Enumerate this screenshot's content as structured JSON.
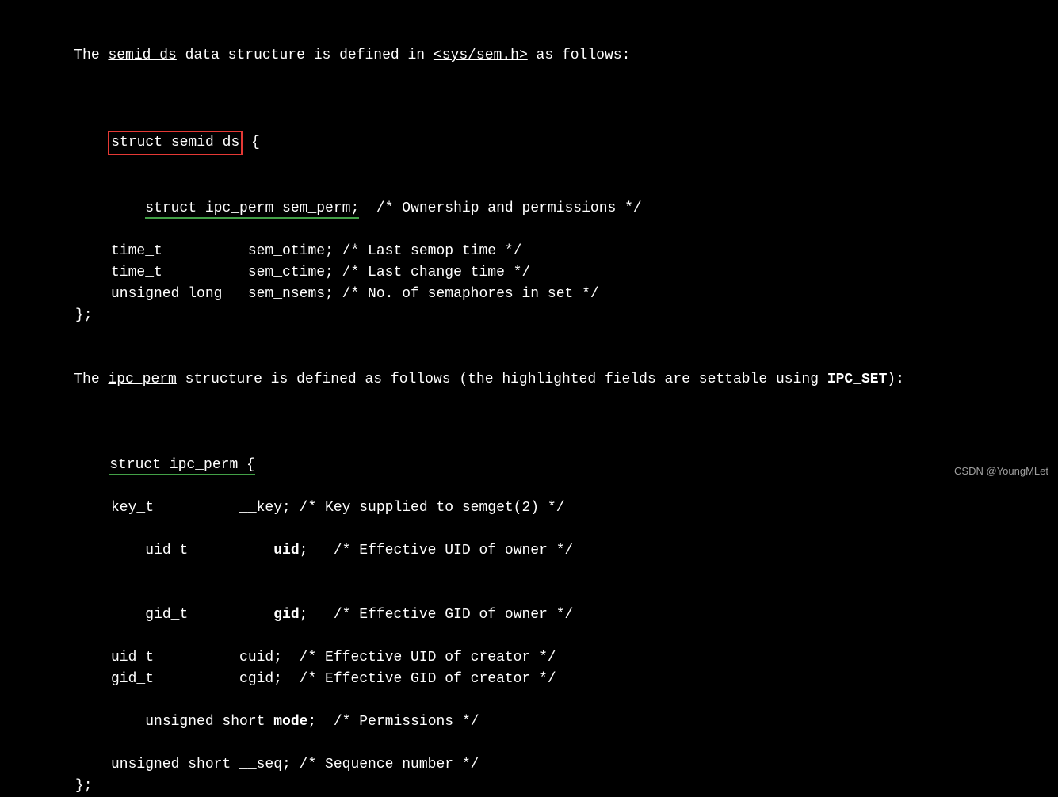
{
  "para1": {
    "pre1": "The ",
    "semid_ds": "semid ds",
    "mid1": " data structure is defined in ",
    "header": "<sys/sem.h>",
    "post1": " as follows:"
  },
  "struct1": {
    "decl_pre": "struct semid_ds",
    "decl_brace": " {",
    "line1_type": "struct ipc_perm sem_perm;",
    "line1_comment": "  /* Ownership and permissions */",
    "line2": "time_t          sem_otime; /* Last semop time */",
    "line3": "time_t          sem_ctime; /* Last change time */",
    "line4": "unsigned long   sem_nsems; /* No. of semaphores in set */",
    "close": "};"
  },
  "para2": {
    "pre1": "The ",
    "ipc_perm": "ipc perm",
    "mid1": " structure is defined as follows (the highlighted fields are settable using ",
    "ipc_set": "IPC_SET",
    "post1": "):"
  },
  "struct2": {
    "decl": "struct ipc_perm {",
    "l1": "key_t          __key; /* Key supplied to semget(2) */",
    "l2a": "uid_t          ",
    "l2b": "uid",
    "l2c": ";   /* Effective UID of owner */",
    "l3a": "gid_t          ",
    "l3b": "gid",
    "l3c": ";   /* Effective GID of owner */",
    "l4": "uid_t          cuid;  /* Effective UID of creator */",
    "l5": "gid_t          cgid;  /* Effective GID of creator */",
    "l6a": "unsigned short ",
    "l6b": "mode",
    "l6c": ";  /* Permissions */",
    "l7": "unsigned short __seq; /* Sequence number */",
    "close": "};"
  },
  "watermark": "CSDN @YoungMLet"
}
